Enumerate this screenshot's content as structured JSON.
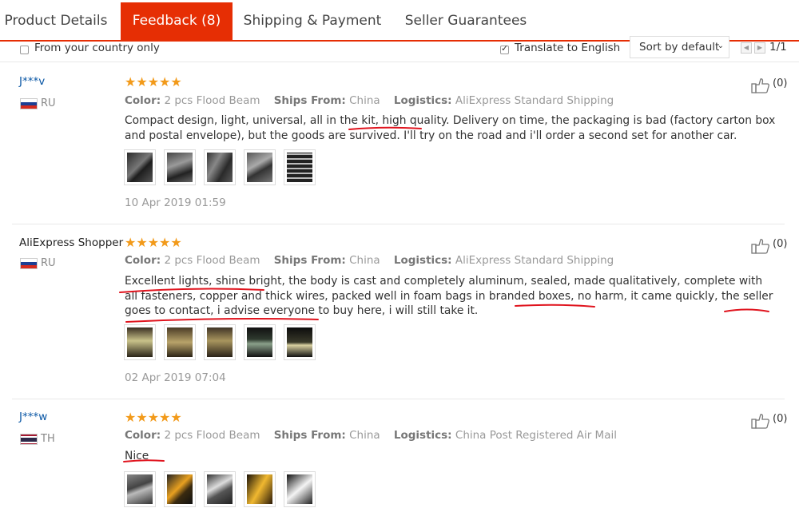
{
  "tabs": [
    {
      "label": "Product Details"
    },
    {
      "label": "Feedback (8)"
    },
    {
      "label": "Shipping & Payment"
    },
    {
      "label": "Seller Guarantees"
    }
  ],
  "filter": {
    "from_country_label": "From your country only",
    "translate_label": "Translate to English",
    "sort_label": "Sort by default",
    "page_info": "1/1"
  },
  "reviews": [
    {
      "user": "J***v",
      "country": "RU",
      "stars": "★★★★★",
      "color_label": "Color:",
      "color_value": "2 pcs Flood Beam",
      "ships_label": "Ships From:",
      "ships_value": "China",
      "logistics_label": "Logistics:",
      "logistics_value": "AliExpress Standard Shipping",
      "text": "Compact design, light, universal, all in the kit, high quality. Delivery on time, the packaging is bad (factory carton box and postal envelope), but the goods are survived. I'll try on the road and i'll order a second set for another car.",
      "date": "10 Apr 2019 01:59",
      "likes": "(0)"
    },
    {
      "user": "AliExpress Shopper",
      "country": "RU",
      "stars": "★★★★★",
      "color_label": "Color:",
      "color_value": "2 pcs Flood Beam",
      "ships_label": "Ships From:",
      "ships_value": "China",
      "logistics_label": "Logistics:",
      "logistics_value": "AliExpress Standard Shipping",
      "text": "Excellent lights, shine bright, the body is cast and completely aluminum, sealed, made qualitatively, complete with all fasteners, copper and thick wires, packed well in foam bags in branded boxes, no harm, it came quickly, the seller goes to contact, i advise everyone to buy here, i will still take it.",
      "date": "02 Apr 2019 07:04",
      "likes": "(0)"
    },
    {
      "user": "J***w",
      "country": "TH",
      "stars": "★★★★★",
      "color_label": "Color:",
      "color_value": "2 pcs Flood Beam",
      "ships_label": "Ships From:",
      "ships_value": "China",
      "logistics_label": "Logistics:",
      "logistics_value": "China Post Registered Air Mail",
      "text": "Nice",
      "likes": "(0)"
    }
  ],
  "colors": {
    "accent": "#e62e04",
    "star": "#f29a1a",
    "link": "#0a57a5",
    "annotation": "#e0141e"
  }
}
